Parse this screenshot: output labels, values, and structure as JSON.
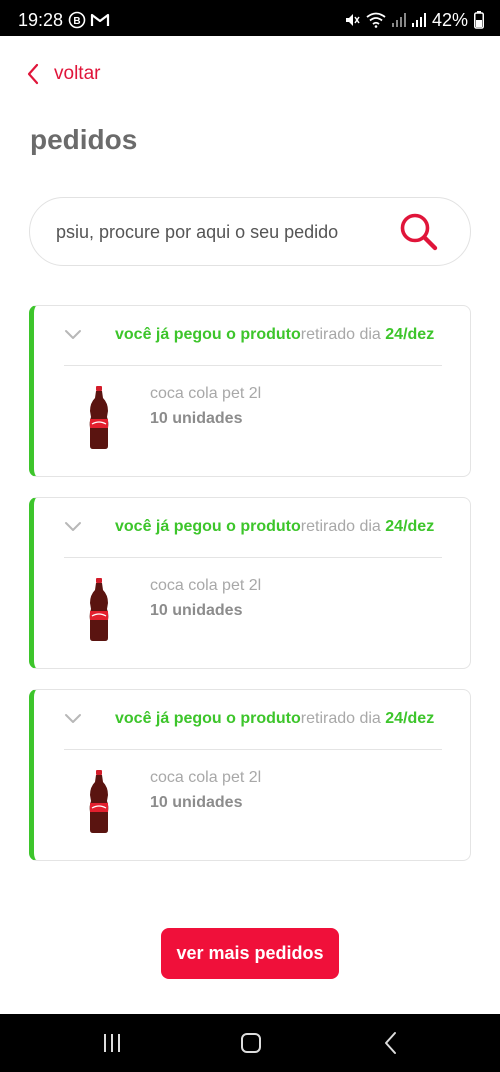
{
  "status_bar": {
    "time": "19:28",
    "battery": "42%",
    "left_icons": [
      "b-circle-icon",
      "gmail-icon"
    ],
    "right_icons": [
      "mute-icon",
      "wifi-icon",
      "signal-icon",
      "signal-icon",
      "battery-icon"
    ]
  },
  "header": {
    "back_label": "voltar",
    "title": "pedidos"
  },
  "search": {
    "placeholder": "psiu, procure por aqui o seu pedido"
  },
  "orders": [
    {
      "status": "você já pegou o produto",
      "date_label": "retirado dia ",
      "date": "24/dez",
      "product_name": "coca cola pet 2l",
      "quantity": "10 unidades"
    },
    {
      "status": "você já pegou o produto",
      "date_label": "retirado dia ",
      "date": "24/dez",
      "product_name": "coca cola pet 2l",
      "quantity": "10 unidades"
    },
    {
      "status": "você já pegou o produto",
      "date_label": "retirado dia ",
      "date": "24/dez",
      "product_name": "coca cola pet 2l",
      "quantity": "10 unidades"
    }
  ],
  "more_button": "ver mais pedidos",
  "colors": {
    "accent_red": "#e0153a",
    "button_red": "#f0103a",
    "success_green": "#3dc52b",
    "title_gray": "#6b6b6b"
  }
}
